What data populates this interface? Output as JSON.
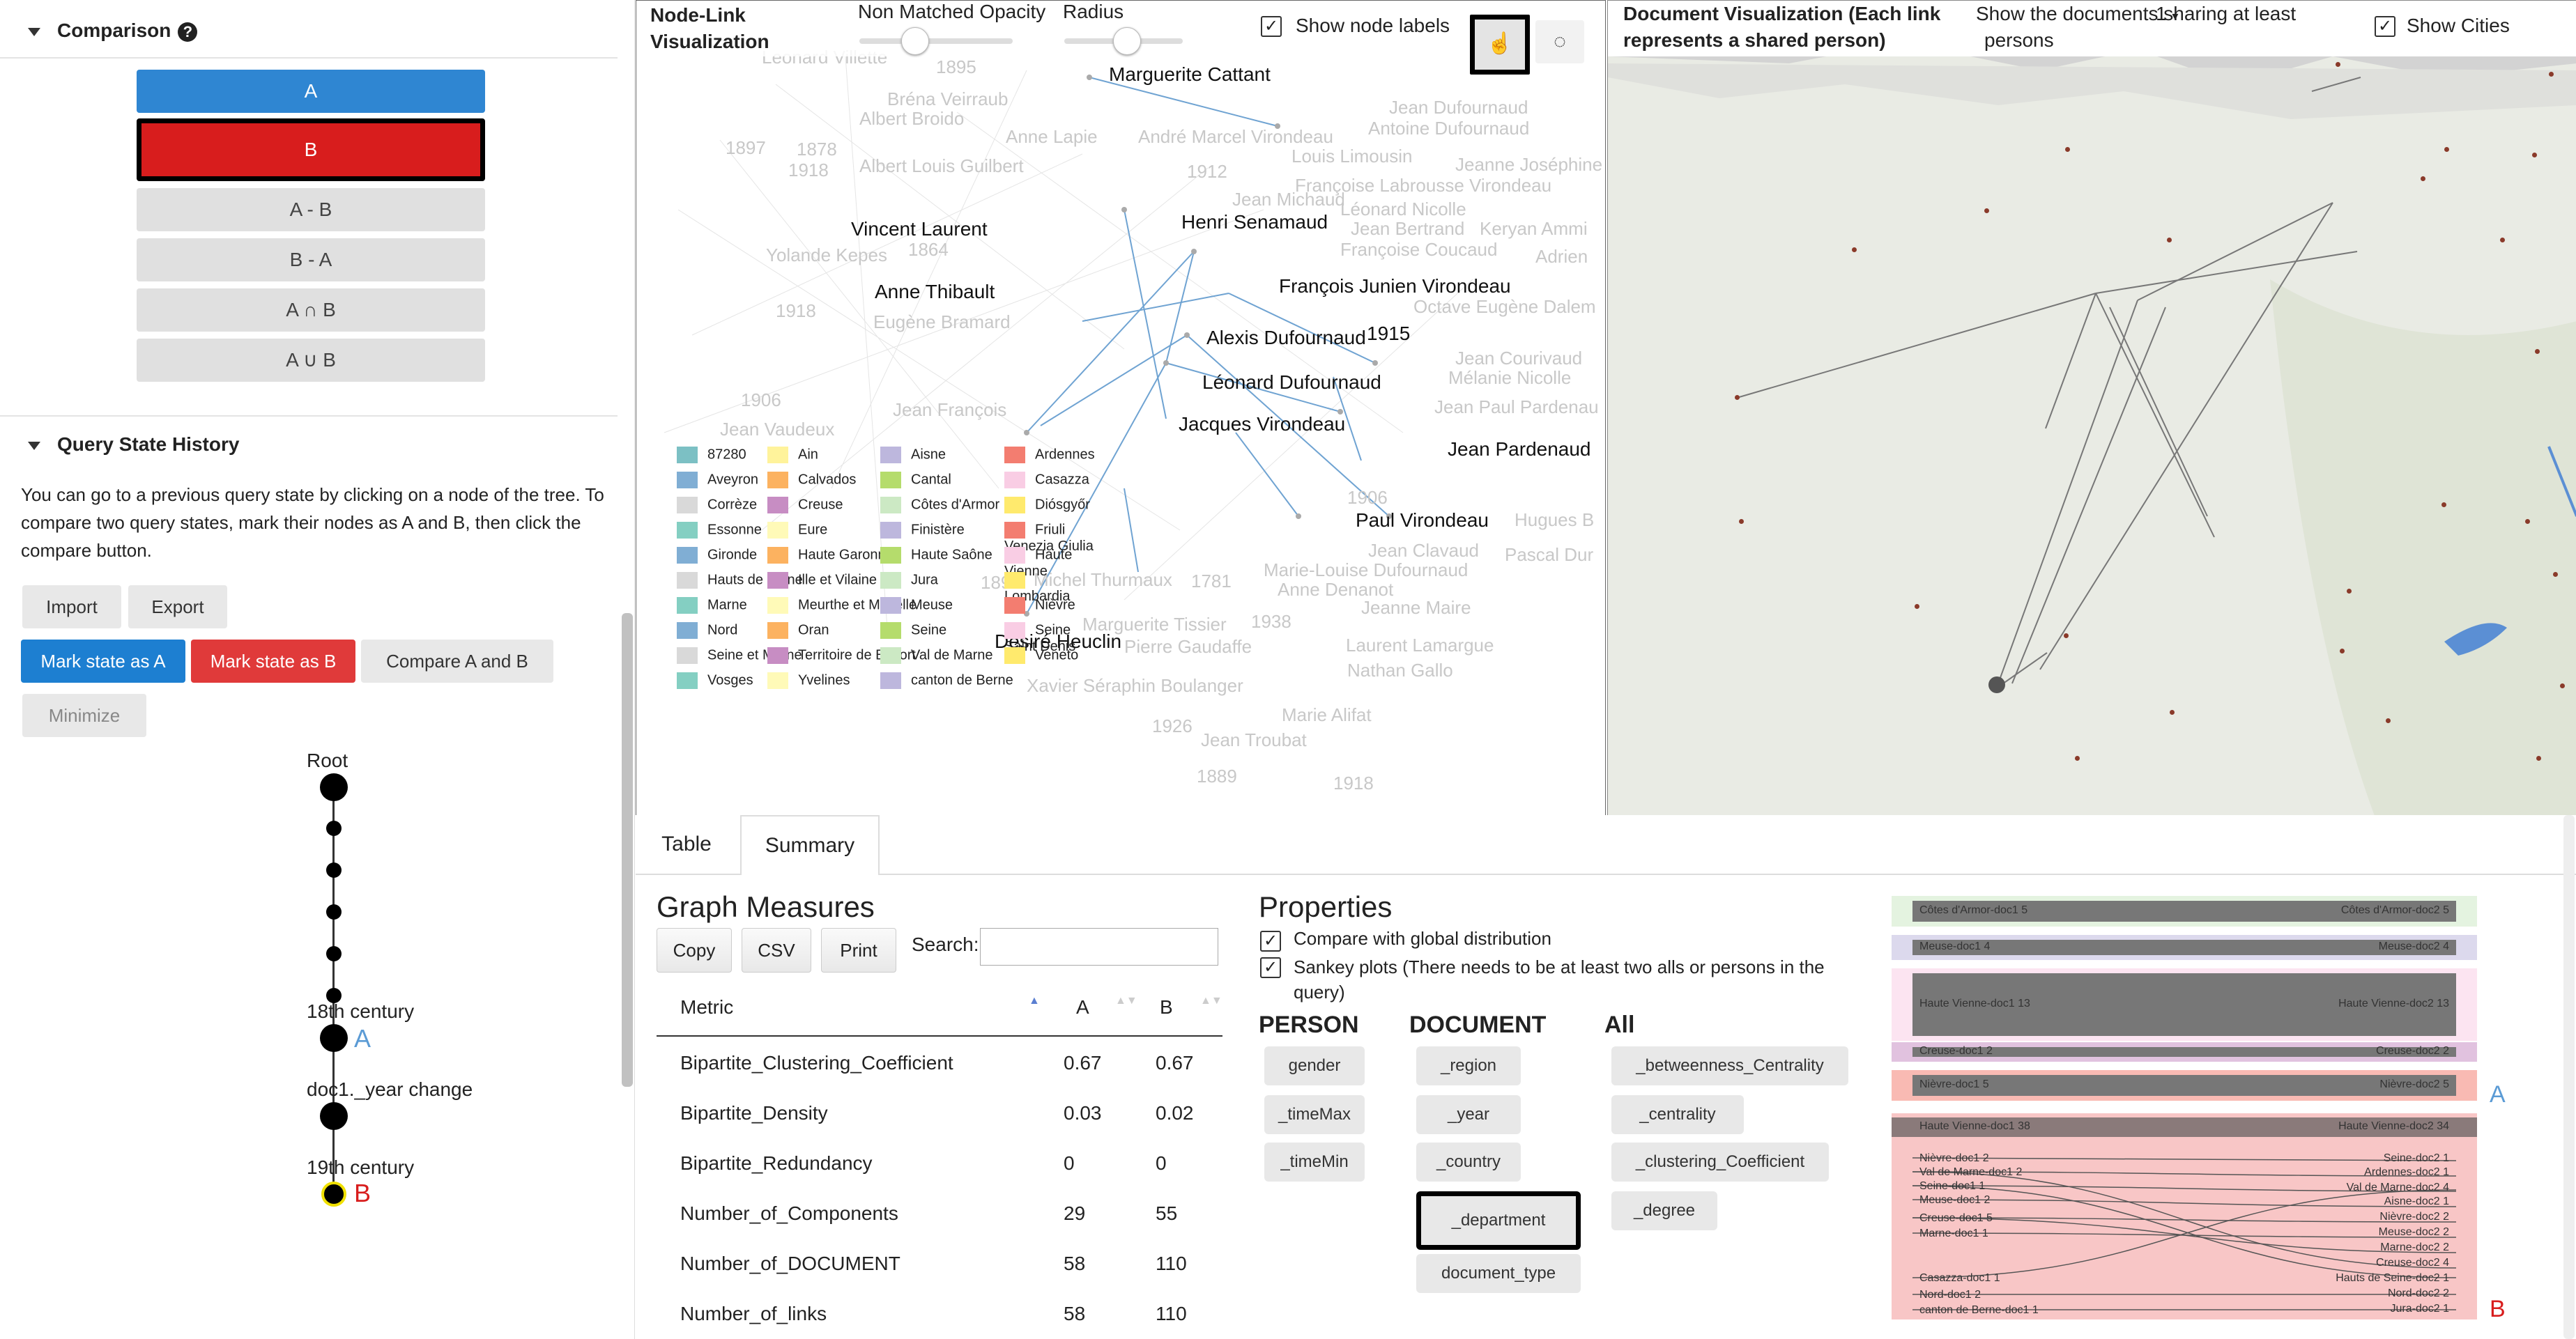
{
  "comparison": {
    "title": "Comparison",
    "buttons": [
      "A",
      "B",
      "A - B",
      "B - A",
      "A ∩ B",
      "A ∪ B"
    ]
  },
  "history": {
    "title": "Query State History",
    "description": "You can go to a previous query state by clicking on a node of the tree. To compare two query states, mark their nodes as A and B, then click the compare button.",
    "import_label": "Import",
    "export_label": "Export",
    "mark_a_label": "Mark state as A",
    "mark_b_label": "Mark state as B",
    "compare_label": "Compare A and B",
    "minimize_label": "Minimize",
    "tree": {
      "root": "Root",
      "n18": "18th century",
      "year_change": "doc1._year change",
      "n19": "19th century",
      "mark_a": "A",
      "mark_b": "B"
    }
  },
  "nodelink": {
    "title": "Node-Link Visualization",
    "opacity_label": "Non Matched Opacity",
    "radius_label": "Radius",
    "show_labels": "Show node labels",
    "names": [
      "Marguerite Cattant",
      "Henri Senamaud",
      "Vincent Laurent",
      "François Junien Virondeau",
      "Anne Thibault",
      "Alexis Dufournaud",
      "1915",
      "Léonard Dufournaud",
      "Jacques Virondeau",
      "Jean Pardenaud",
      "Paul Virondeau",
      "Désiré Heuclin"
    ],
    "faint": [
      "Leonard Villette",
      "1895",
      "Bréna Veirraub",
      "Albert Broido",
      "Anne Lapie",
      "André Marcel Virondeau",
      "1897",
      "1878",
      "1918",
      "Albert Louis Guilbert",
      "1912",
      "Jean Dufournaud",
      "Antoine Dufournaud",
      "Louis Limousin",
      "Jeanne Joséphine",
      "Françoise Labrousse Virondeau",
      "Jean Michaud",
      "Léonard Nicolle",
      "Jean Bertrand",
      "Keryan Ammi",
      "Yolande Kepes",
      "1864",
      "Françoise Coucaud",
      "Adrien",
      "1918",
      "Eugène Bramard",
      "Octave Eugène Dalem",
      "Jean Courivaud",
      "Mélanie Nicolle",
      "1906",
      "Jean François",
      "Jean Paul Pardenau",
      "Jean Vaudeux",
      "1906",
      "Hugues B",
      "Jean Clavaud",
      "Pascal Dur",
      "Marie-Louise Dufournaud",
      "Anne Denanot",
      "1891",
      "Michel Thurmaux",
      "1781",
      "Jeanne Maire",
      "Marguerite Tissier",
      "1938",
      "Laurent Lamargue",
      "Nathan Gallo",
      "Xavier Séraphin Boulanger",
      "Pierre Gaudaffe",
      "Marie Alifat",
      "1926",
      "Jean Troubat",
      "1889",
      "1918"
    ],
    "legend": [
      [
        "87280",
        "#7cc0c4"
      ],
      [
        "Ain",
        "#fff39b"
      ],
      [
        "Aisne",
        "#bdb7dd"
      ],
      [
        "Ardennes",
        "#f37d70"
      ],
      [
        "Aveyron",
        "#80aed4"
      ],
      [
        "Calvados",
        "#fcb260"
      ],
      [
        "Cantal",
        "#b5dc6c"
      ],
      [
        "Casazza",
        "#f9cde4"
      ],
      [
        "Corrèze",
        "#d9d9d9"
      ],
      [
        "Creuse",
        "#c78dc3"
      ],
      [
        "Côtes d'Armor",
        "#cce9c4"
      ],
      [
        "Diósgyőr",
        "#ffea6d"
      ],
      [
        "Essonne",
        "#84cfc2"
      ],
      [
        "Eure",
        "#fffab8"
      ],
      [
        "Finistère",
        "#bdb7dd"
      ],
      [
        "Friuli Venezia Giulia",
        "#f37d70"
      ],
      [
        "Gironde",
        "#80aed4"
      ],
      [
        "Haute Garonne",
        "#fcb260"
      ],
      [
        "Haute Saône",
        "#b5dc6c"
      ],
      [
        "Haute Vienne",
        "#f9cde4"
      ],
      [
        "Hauts de Seine",
        "#d9d9d9"
      ],
      [
        "Ille et Vilaine",
        "#c78dc3"
      ],
      [
        "Jura",
        "#cce9c4"
      ],
      [
        "Lombardia",
        "#ffea6d"
      ],
      [
        "Marne",
        "#84cfc2"
      ],
      [
        "Meurthe et Moselle",
        "#fffab8"
      ],
      [
        "Meuse",
        "#bdb7dd"
      ],
      [
        "Nièvre",
        "#f37d70"
      ],
      [
        "Nord",
        "#80aed4"
      ],
      [
        "Oran",
        "#fcb260"
      ],
      [
        "Seine",
        "#b5dc6c"
      ],
      [
        "Seine Saint Denis",
        "#f9cde4"
      ],
      [
        "Seine et Marne",
        "#d9d9d9"
      ],
      [
        "Territoire de Belfort",
        "#c78dc3"
      ],
      [
        "Val de Marne",
        "#cce9c4"
      ],
      [
        "Veneto",
        "#ffea6d"
      ],
      [
        "Vosges",
        "#84cfc2"
      ],
      [
        "Yvelines",
        "#fffab8"
      ],
      [
        "canton de Berne",
        "#bdb7dd"
      ]
    ]
  },
  "docviz": {
    "title": "Document Visualization (Each link represents a shared person)",
    "sharing_label": "Show the documents sharing at least",
    "sharing_value": "1",
    "sharing_suffix": "persons",
    "show_cities": "Show Cities"
  },
  "tabs": [
    "Table",
    "Summary"
  ],
  "measures": {
    "title": "Graph Measures",
    "copy": "Copy",
    "csv": "CSV",
    "print": "Print",
    "search_label": "Search:",
    "columns": [
      "Metric",
      "A",
      "B"
    ],
    "rows": [
      [
        "Bipartite_Clustering_Coefficient",
        "0.67",
        "0.67"
      ],
      [
        "Bipartite_Density",
        "0.03",
        "0.02"
      ],
      [
        "Bipartite_Redundancy",
        "0",
        "0"
      ],
      [
        "Number_of_Components",
        "29",
        "55"
      ],
      [
        "Number_of_DOCUMENT",
        "58",
        "110"
      ],
      [
        "Number_of_links",
        "58",
        "110"
      ]
    ]
  },
  "properties": {
    "title": "Properties",
    "compare_global": "Compare with global distribution",
    "sankey": "Sankey plots (There needs to be at least two alls or persons in the query)",
    "columns": [
      "PERSON",
      "DOCUMENT",
      "All"
    ],
    "person": [
      "gender",
      "_timeMax",
      "_timeMin"
    ],
    "document": [
      "_region",
      "_year",
      "_country",
      "_department",
      "document_type"
    ],
    "all": [
      "_betweenness_Centrality",
      "_centrality",
      "_clustering_Coefficient",
      "_degree"
    ]
  },
  "sankey": {
    "label_a": "A",
    "label_b": "B",
    "a_rows": [
      [
        "Côtes d'Armor-doc1 5",
        "Côtes d'Armor-doc2 5"
      ],
      [
        "Meuse-doc1 4",
        "Meuse-doc2 4"
      ],
      [
        "Haute Vienne-doc1 13",
        "Haute Vienne-doc2 13"
      ],
      [
        "Creuse-doc1 2",
        "Creuse-doc2 2"
      ],
      [
        "Nièvre-doc1 5",
        "Nièvre-doc2 5"
      ]
    ],
    "b_top": [
      "Haute Vienne-doc1 38",
      "Haute Vienne-doc2 34"
    ],
    "b_left": [
      "Nièvre-doc1 2",
      "Val de Marne-doc1 2",
      "Seine-doc1 1",
      "Meuse-doc1 2",
      "Creuse-doc1 5",
      "Marne-doc1 1",
      "Casazza-doc1 1",
      "Nord-doc1 2",
      "canton de Berne-doc1 1"
    ],
    "b_right": [
      "Seine-doc2 1",
      "Ardennes-doc2 1",
      "Val de Marne-doc2 4",
      "Aisne-doc2 1",
      "Nièvre-doc2 2",
      "Meuse-doc2 2",
      "Marne-doc2 2",
      "Creuse-doc2 4",
      "Hauts de Seine-doc2 1",
      "Nord-doc2 2",
      "Jura-doc2 1"
    ]
  }
}
